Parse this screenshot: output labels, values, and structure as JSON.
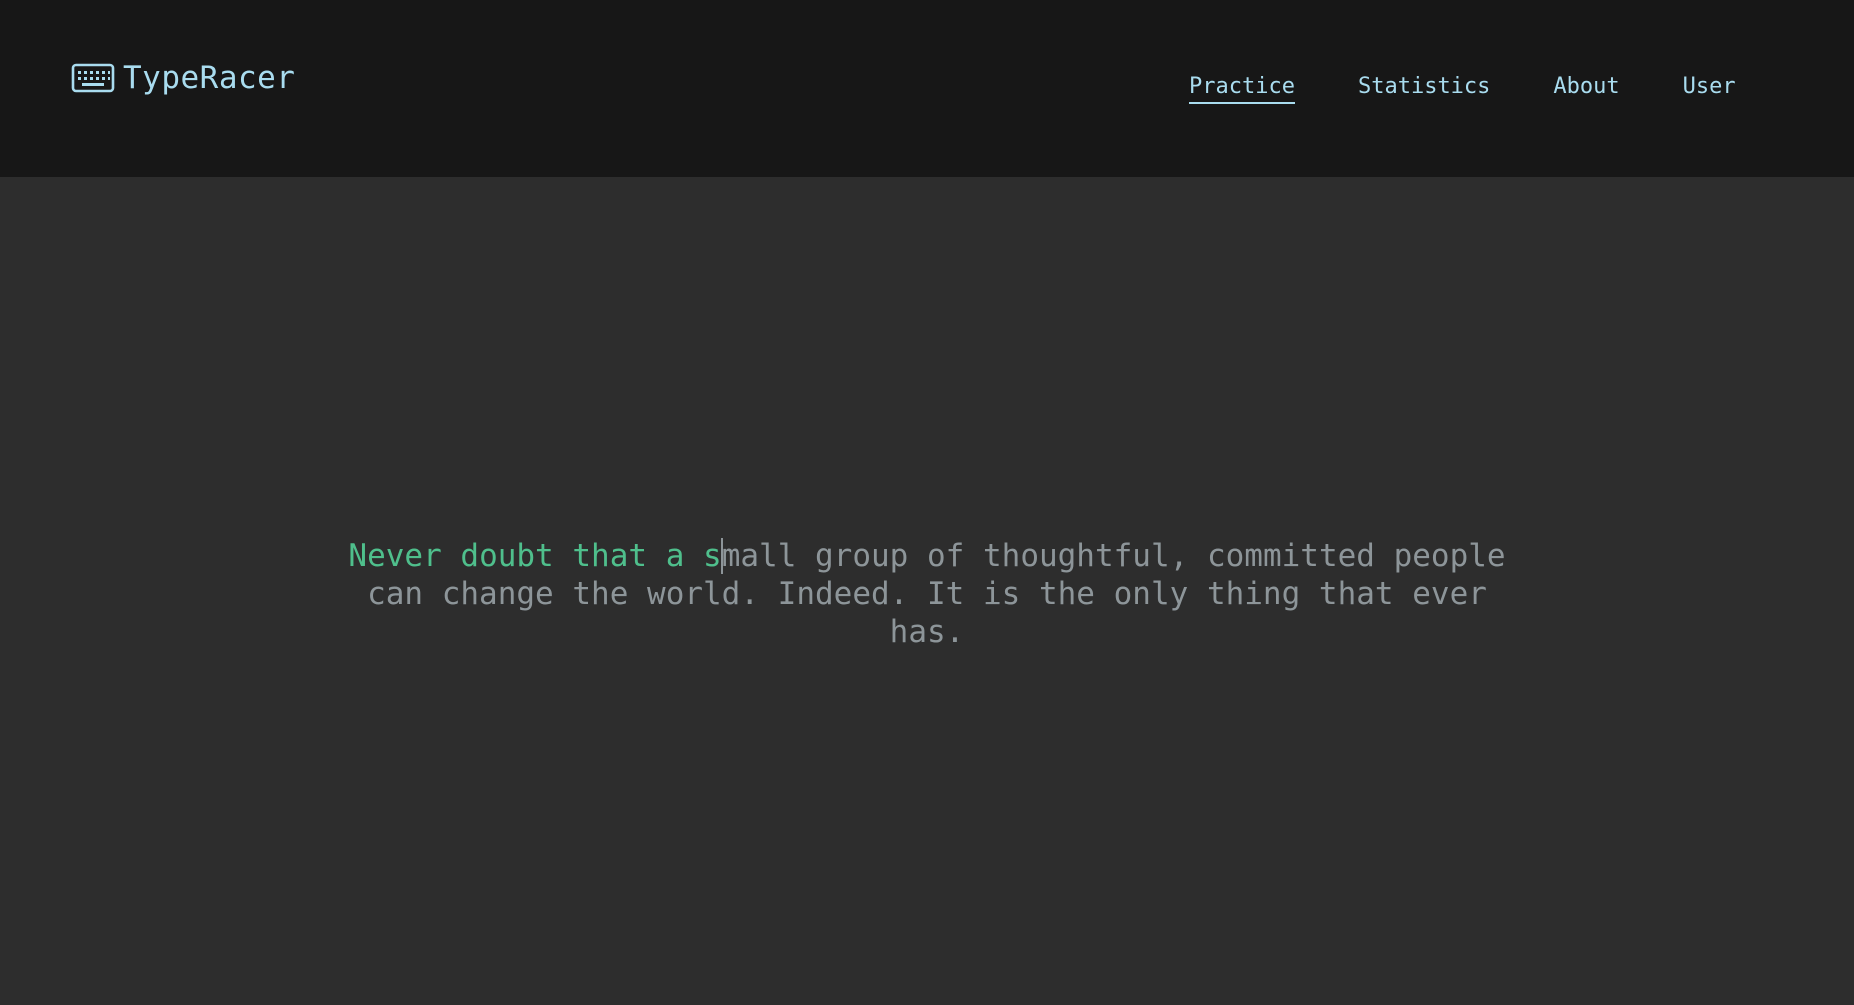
{
  "app": {
    "title": "TypeRacer",
    "logo_icon": "keyboard-icon",
    "accent_color": "#a9dcef",
    "typed_color": "#4fbf8c",
    "untyped_color": "#8d9599"
  },
  "nav": {
    "items": [
      {
        "label": "Practice",
        "active": true
      },
      {
        "label": "Statistics",
        "active": false
      },
      {
        "label": "About",
        "active": false
      },
      {
        "label": "User",
        "active": false
      }
    ]
  },
  "passage": {
    "typed": "Never doubt that a s",
    "remaining": "mall group of thoughtful, committed people can change the world. Indeed. It is the only thing that ever has."
  }
}
